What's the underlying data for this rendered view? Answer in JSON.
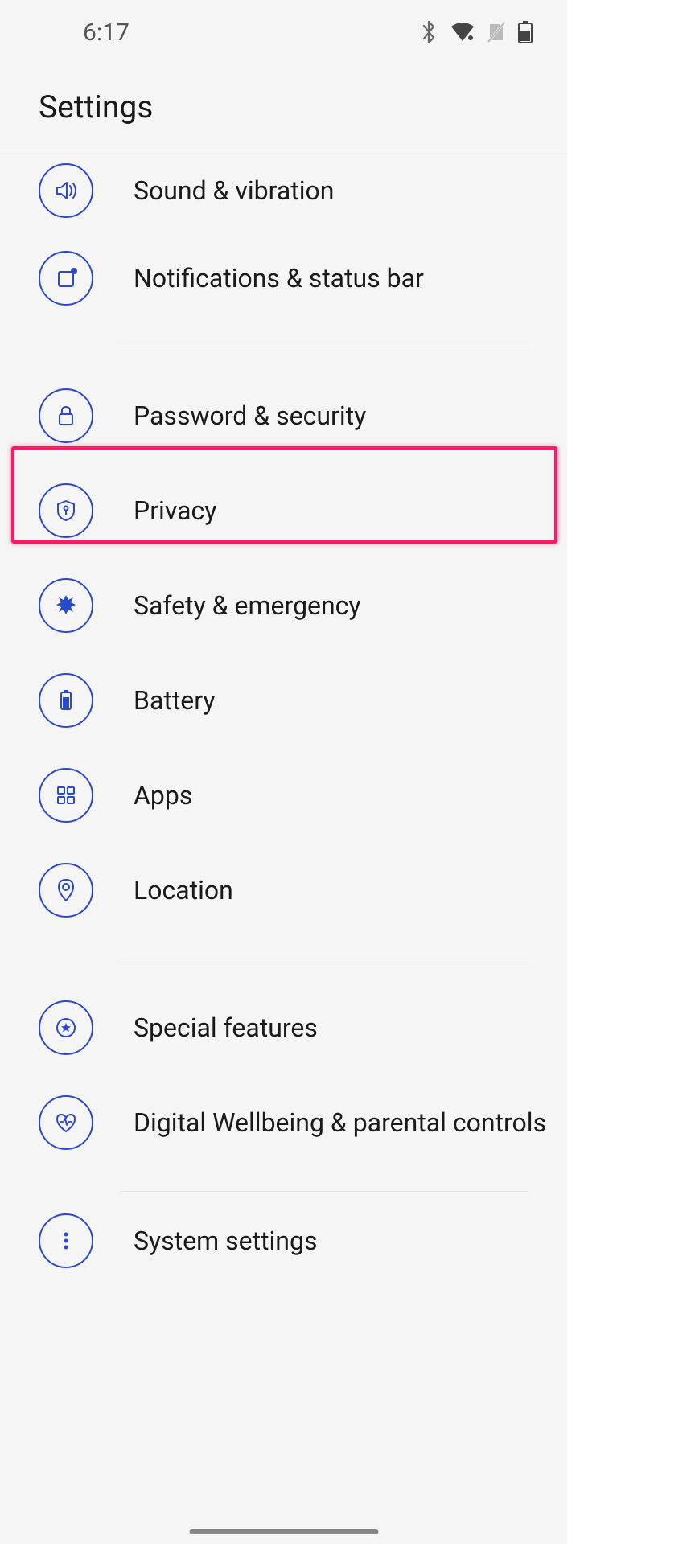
{
  "status": {
    "time": "6:17"
  },
  "header": {
    "title": "Settings"
  },
  "items": [
    {
      "label": "Sound & vibration",
      "icon": "sound-icon"
    },
    {
      "label": "Notifications & status bar",
      "icon": "notifications-icon"
    },
    {
      "label": "Password & security",
      "icon": "lock-icon"
    },
    {
      "label": "Privacy",
      "icon": "privacy-icon"
    },
    {
      "label": "Safety & emergency",
      "icon": "emergency-icon"
    },
    {
      "label": "Battery",
      "icon": "battery-icon"
    },
    {
      "label": "Apps",
      "icon": "apps-icon"
    },
    {
      "label": "Location",
      "icon": "location-icon"
    },
    {
      "label": "Special features",
      "icon": "star-icon"
    },
    {
      "label": "Digital Wellbeing & parental controls",
      "icon": "wellbeing-icon"
    },
    {
      "label": "System settings",
      "icon": "more-icon"
    }
  ],
  "highlighted_item": "Privacy",
  "colors": {
    "accent": "#2b4acb",
    "highlight": "#ff1a66"
  }
}
